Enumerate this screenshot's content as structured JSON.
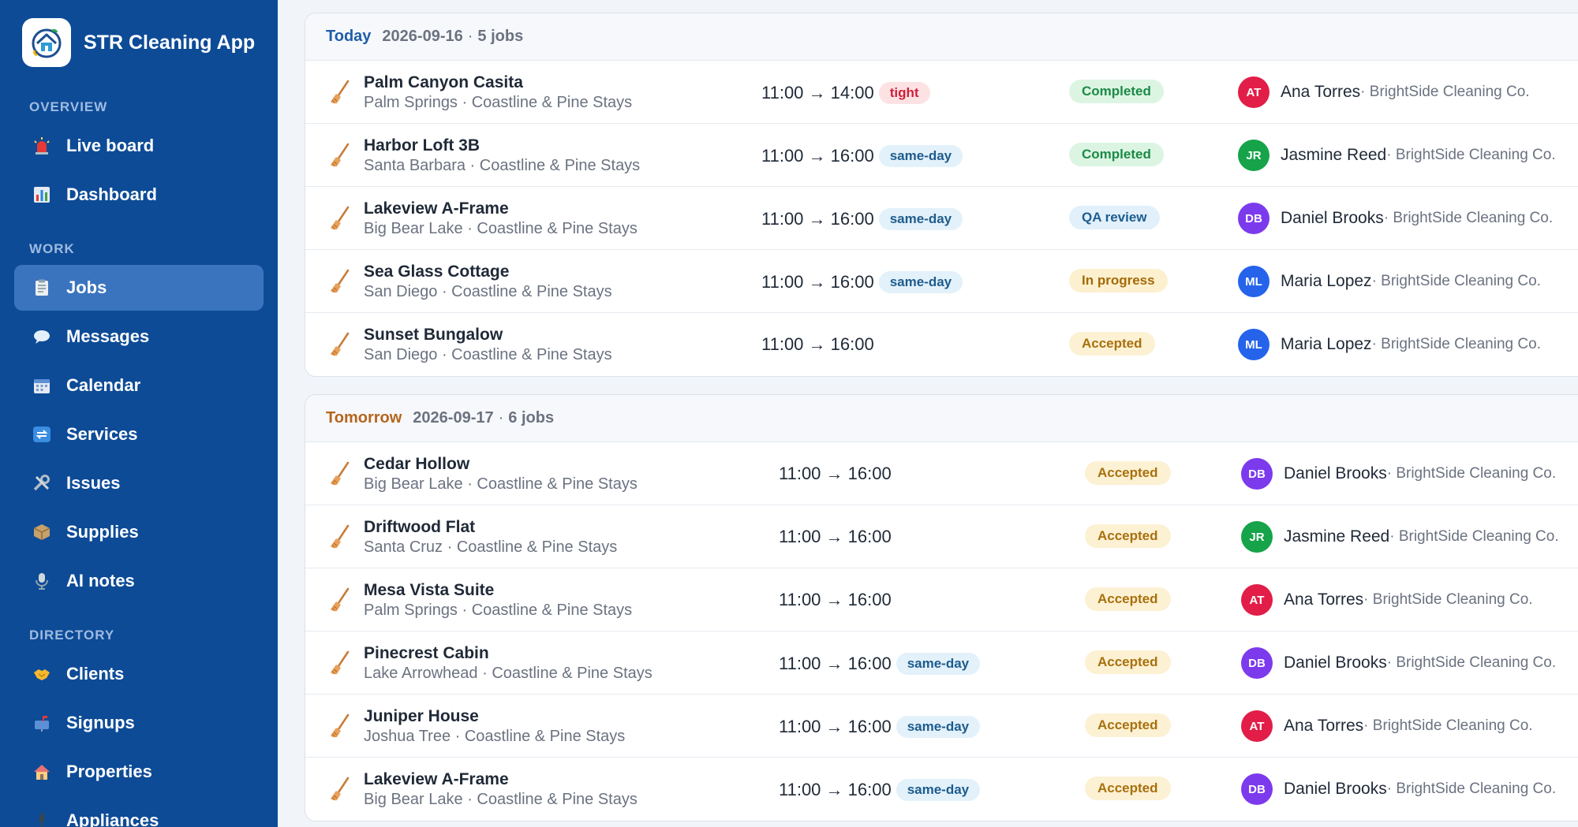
{
  "app": {
    "title": "STR Cleaning App"
  },
  "sidebar": {
    "sections": [
      {
        "label": "OVERVIEW",
        "items": [
          {
            "label": "Live board",
            "icon": "siren-icon",
            "key": "live-board"
          },
          {
            "label": "Dashboard",
            "icon": "bar-chart-icon",
            "key": "dashboard"
          }
        ]
      },
      {
        "label": "WORK",
        "items": [
          {
            "label": "Jobs",
            "icon": "clipboard-icon",
            "key": "jobs",
            "active": true
          },
          {
            "label": "Messages",
            "icon": "speech-bubble-icon",
            "key": "messages"
          },
          {
            "label": "Calendar",
            "icon": "calendar-icon",
            "key": "calendar"
          },
          {
            "label": "Services",
            "icon": "repeat-icon",
            "key": "services"
          },
          {
            "label": "Issues",
            "icon": "tools-icon",
            "key": "issues"
          },
          {
            "label": "Supplies",
            "icon": "package-icon",
            "key": "supplies"
          },
          {
            "label": "AI notes",
            "icon": "microphone-icon",
            "key": "ai-notes"
          }
        ]
      },
      {
        "label": "DIRECTORY",
        "items": [
          {
            "label": "Clients",
            "icon": "handshake-icon",
            "key": "clients"
          },
          {
            "label": "Signups",
            "icon": "mailbox-icon",
            "key": "signups"
          },
          {
            "label": "Properties",
            "icon": "house-icon",
            "key": "properties"
          },
          {
            "label": "Appliances",
            "icon": "plug-icon",
            "key": "appliances"
          }
        ]
      }
    ]
  },
  "days": [
    {
      "label": "Today",
      "variant": "today",
      "date": "2026-09-16",
      "sep": "·",
      "count": "5 jobs",
      "jobs": [
        {
          "name": "Palm Canyon Casita",
          "location": "Palm Springs · Coastline & Pine Stays",
          "time": "11:00 → 14:00",
          "tag": "tight",
          "tag_style": "tight",
          "status": "Completed",
          "status_style": "completed",
          "initials": "AT",
          "avatar_style": "at",
          "cleaner": "Ana Torres",
          "company": " · BrightSide Cleaning Co."
        },
        {
          "name": "Harbor Loft 3B",
          "location": "Santa Barbara · Coastline & Pine Stays",
          "time": "11:00 → 16:00",
          "tag": "same-day",
          "tag_style": "same-day",
          "status": "Completed",
          "status_style": "completed",
          "initials": "JR",
          "avatar_style": "jr",
          "cleaner": "Jasmine Reed",
          "company": " · BrightSide Cleaning Co."
        },
        {
          "name": "Lakeview A-Frame",
          "location": "Big Bear Lake · Coastline & Pine Stays",
          "time": "11:00 → 16:00",
          "tag": "same-day",
          "tag_style": "same-day",
          "status": "QA review",
          "status_style": "qa",
          "initials": "DB",
          "avatar_style": "db",
          "cleaner": "Daniel Brooks",
          "company": " · BrightSide Cleaning Co."
        },
        {
          "name": "Sea Glass Cottage",
          "location": "San Diego · Coastline & Pine Stays",
          "time": "11:00 → 16:00",
          "tag": "same-day",
          "tag_style": "same-day",
          "status": "In progress",
          "status_style": "progress",
          "initials": "ML",
          "avatar_style": "ml",
          "cleaner": "Maria Lopez",
          "company": " · BrightSide Cleaning Co."
        },
        {
          "name": "Sunset Bungalow",
          "location": "San Diego · Coastline & Pine Stays",
          "time": "11:00 → 16:00",
          "tag": "",
          "tag_style": "",
          "status": "Accepted",
          "status_style": "accepted",
          "initials": "ML",
          "avatar_style": "ml",
          "cleaner": "Maria Lopez",
          "company": " · BrightSide Cleaning Co."
        }
      ]
    },
    {
      "label": "Tomorrow",
      "variant": "tomorrow",
      "date": "2026-09-17",
      "sep": "·",
      "count": "6 jobs",
      "jobs": [
        {
          "name": "Cedar Hollow",
          "location": "Big Bear Lake · Coastline & Pine Stays",
          "time": "11:00 → 16:00",
          "tag": "",
          "tag_style": "",
          "status": "Accepted",
          "status_style": "accepted",
          "initials": "DB",
          "avatar_style": "db",
          "cleaner": "Daniel Brooks",
          "company": " · BrightSide Cleaning Co."
        },
        {
          "name": "Driftwood Flat",
          "location": "Santa Cruz · Coastline & Pine Stays",
          "time": "11:00 → 16:00",
          "tag": "",
          "tag_style": "",
          "status": "Accepted",
          "status_style": "accepted",
          "initials": "JR",
          "avatar_style": "jr",
          "cleaner": "Jasmine Reed",
          "company": " · BrightSide Cleaning Co."
        },
        {
          "name": "Mesa Vista Suite",
          "location": "Palm Springs · Coastline & Pine Stays",
          "time": "11:00 → 16:00",
          "tag": "",
          "tag_style": "",
          "status": "Accepted",
          "status_style": "accepted",
          "initials": "AT",
          "avatar_style": "at",
          "cleaner": "Ana Torres",
          "company": " · BrightSide Cleaning Co."
        },
        {
          "name": "Pinecrest Cabin",
          "location": "Lake Arrowhead · Coastline & Pine Stays",
          "time": "11:00 → 16:00",
          "tag": "same-day",
          "tag_style": "same-day",
          "status": "Accepted",
          "status_style": "accepted",
          "initials": "DB",
          "avatar_style": "db",
          "cleaner": "Daniel Brooks",
          "company": " · BrightSide Cleaning Co."
        },
        {
          "name": "Juniper House",
          "location": "Joshua Tree · Coastline & Pine Stays",
          "time": "11:00 → 16:00",
          "tag": "same-day",
          "tag_style": "same-day",
          "status": "Accepted",
          "status_style": "accepted",
          "initials": "AT",
          "avatar_style": "at",
          "cleaner": "Ana Torres",
          "company": " · BrightSide Cleaning Co."
        },
        {
          "name": "Lakeview A-Frame",
          "location": "Big Bear Lake · Coastline & Pine Stays",
          "time": "11:00 → 16:00",
          "tag": "same-day",
          "tag_style": "same-day",
          "status": "Accepted",
          "status_style": "accepted",
          "initials": "DB",
          "avatar_style": "db",
          "cleaner": "Daniel Brooks",
          "company": " · BrightSide Cleaning Co."
        }
      ]
    }
  ]
}
